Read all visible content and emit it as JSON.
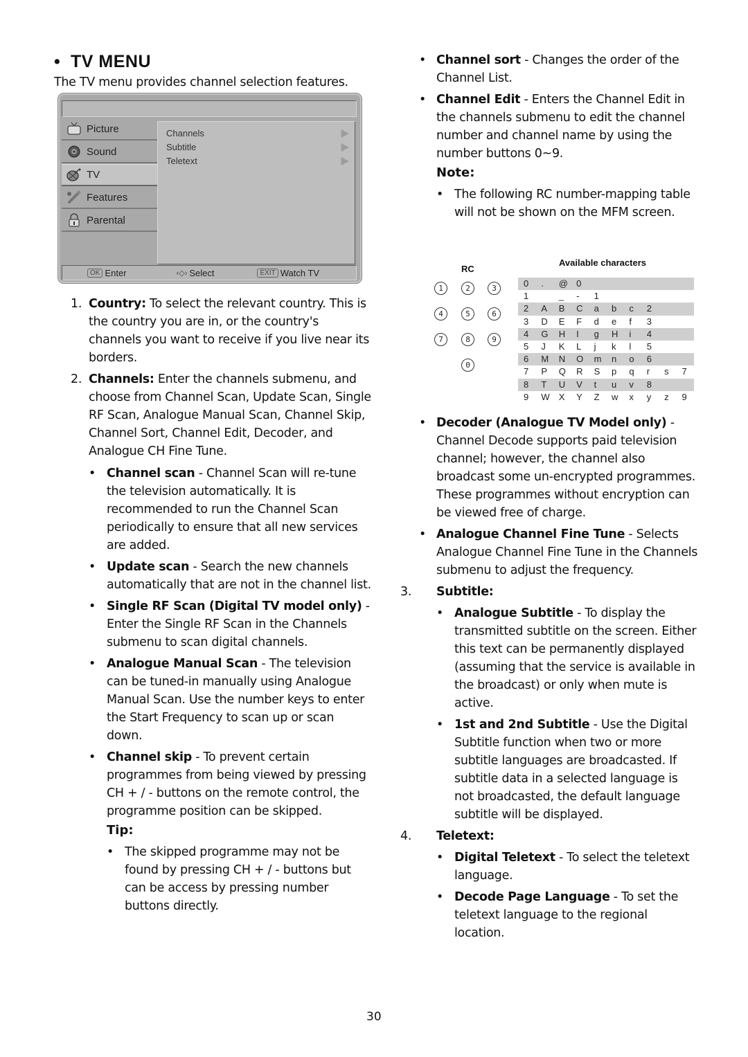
{
  "section": {
    "bullet": "•",
    "title": "TV MENU",
    "intro": "The TV menu provides channel selection features."
  },
  "osd": {
    "sidebar": [
      {
        "label": "Picture",
        "icon": "tv-icon"
      },
      {
        "label": "Sound",
        "icon": "speaker-icon"
      },
      {
        "label": "TV",
        "icon": "satellite-icon"
      },
      {
        "label": "Features",
        "icon": "wrench-icon"
      },
      {
        "label": "Parental",
        "icon": "lock-icon"
      }
    ],
    "active_item": "TV",
    "submenu": [
      {
        "label": "Channels",
        "arrow": "|||▶"
      },
      {
        "label": "Subtitle",
        "arrow": "|||▶"
      },
      {
        "label": "Teletext",
        "arrow": "|||▶"
      }
    ],
    "footer": {
      "ok_key": "OK",
      "ok_label": "Enter",
      "select_glyph": "‹◇›",
      "select_label": "Select",
      "exit_key": "EXIT",
      "exit_label": "Watch TV"
    }
  },
  "left": {
    "items": [
      {
        "num": "1.",
        "bold": "Country:",
        "text": " To select the relevant country. This is the country you are in, or the country's channels you want to receive if you live near its borders."
      },
      {
        "num": "2.",
        "bold": "Channels:",
        "text": " Enter the channels submenu, and choose from Channel Scan, Update Scan, Single RF Scan, Analogue Manual Scan, Channel Skip, Channel Sort, Channel Edit, Decoder, and Analogue CH Fine Tune."
      }
    ],
    "bullets": [
      {
        "bold": "Channel scan",
        "text": " - Channel Scan will re-tune the television automatically. It is recommended to run the Channel Scan periodically to ensure that all new services are added."
      },
      {
        "bold": "Update scan",
        "text": " - Search the new channels automatically that are not in the channel list."
      },
      {
        "bold": "Single RF Scan (Digital TV model only)",
        "text": " - Enter the Single RF Scan in the Channels submenu to scan digital channels."
      },
      {
        "bold": "Analogue Manual Scan",
        "text": " - The television can be tuned-in manually using Analogue Manual Scan. Use the number keys to enter the Start Frequency to scan up or scan down."
      },
      {
        "bold": "Channel skip",
        "text": " - To prevent certain programmes from being viewed by pressing CH + / - buttons on the remote control, the programme position can be skipped."
      }
    ],
    "tip_title": "Tip:",
    "tip_text": "The skipped programme may not be found by pressing CH + / - buttons but can be access by pressing number buttons directly."
  },
  "right": {
    "bullets_top": [
      {
        "bold": "Channel sort",
        "text": " - Changes the order of the Channel List."
      },
      {
        "bold": "Channel Edit",
        "text": " - Enters the Channel Edit in the channels submenu to edit the channel number and channel name by using the number buttons 0~9."
      }
    ],
    "note_title": "Note:",
    "note_text": "The following RC number-mapping table will not be shown on the MFM screen.",
    "rc_label": "RC",
    "rc_buttons": [
      "1",
      "2",
      "3",
      "4",
      "5",
      "6",
      "7",
      "8",
      "9",
      "0"
    ],
    "table_title": "Available characters",
    "char_rows": [
      [
        "0",
        ".",
        "@",
        "0",
        "",
        "",
        "",
        "",
        "",
        ""
      ],
      [
        "1",
        "",
        "_",
        "-",
        "1",
        "",
        "",
        "",
        "",
        ""
      ],
      [
        "2",
        "A",
        "B",
        "C",
        "a",
        "b",
        "c",
        "2",
        "",
        ""
      ],
      [
        "3",
        "D",
        "E",
        "F",
        "d",
        "e",
        "f",
        "3",
        "",
        ""
      ],
      [
        "4",
        "G",
        "H",
        "I",
        "g",
        "H",
        "i",
        "4",
        "",
        ""
      ],
      [
        "5",
        "J",
        "K",
        "L",
        "j",
        "k",
        "l",
        "5",
        "",
        ""
      ],
      [
        "6",
        "M",
        "N",
        "O",
        "m",
        "n",
        "o",
        "6",
        "",
        ""
      ],
      [
        "7",
        "P",
        "Q",
        "R",
        "S",
        "p",
        "q",
        "r",
        "s",
        "7"
      ],
      [
        "8",
        "T",
        "U",
        "V",
        "t",
        "u",
        "v",
        "8",
        "",
        ""
      ],
      [
        "9",
        "W",
        "X",
        "Y",
        "Z",
        "w",
        "x",
        "y",
        "z",
        "9"
      ]
    ],
    "bullets_mid": [
      {
        "bold": "Decoder (Analogue TV Model only)",
        "text": " - Channel Decode supports paid television channel; however, the channel also broadcast some un-encrypted programmes. These programmes without encryption can be viewed free of charge."
      },
      {
        "bold": "Analogue Channel Fine Tune",
        "text": " - Selects Analogue Channel Fine Tune in the Channels submenu to adjust the frequency."
      }
    ],
    "subtitle": {
      "num": "3.",
      "title": "Subtitle:",
      "items": [
        {
          "bold": "Analogue Subtitle",
          "text": " - To display the transmitted subtitle on the screen. Either this text can be permanently displayed (assuming that the service is available in the broadcast) or only when mute is active."
        },
        {
          "bold": "1st and 2nd Subtitle",
          "text": " - Use the Digital Subtitle function when two or more subtitle languages are broadcasted. If subtitle data in a selected language is not broadcasted, the default language subtitle will be displayed."
        }
      ]
    },
    "teletext": {
      "num": "4.",
      "title": "Teletext:",
      "items": [
        {
          "bold": "Digital Teletext",
          "text": " - To select the teletext language."
        },
        {
          "bold": "Decode Page Language",
          "text": " - To set the teletext language to the regional location."
        }
      ]
    }
  },
  "bullet_glyph": "•",
  "page_number": "30"
}
